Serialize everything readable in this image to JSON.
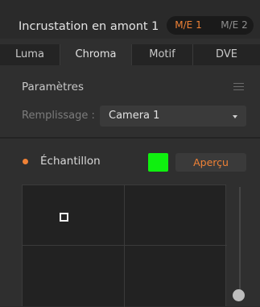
{
  "header": {
    "title": "Incrustation en amont 1"
  },
  "me_buttons": [
    {
      "label": "M/E 1",
      "active": true
    },
    {
      "label": "M/E 2",
      "active": false
    }
  ],
  "tabs": [
    {
      "label": "Luma",
      "active": false
    },
    {
      "label": "Chroma",
      "active": true
    },
    {
      "label": "Motif",
      "active": false
    },
    {
      "label": "DVE",
      "active": false
    }
  ],
  "params": {
    "title": "Paramètres",
    "fill_label": "Remplissage :",
    "fill_value": "Camera 1"
  },
  "sample": {
    "label": "Échantillon",
    "preview_label": "Aperçu",
    "swatch_color": "#0ff00f"
  },
  "colors": {
    "accent": "#f08236",
    "background": "#2f2f2f"
  },
  "icons": {
    "menu": "hamburger-menu-icon",
    "dropdown": "chevron-down-icon",
    "indicator": "dot-indicator-icon"
  }
}
